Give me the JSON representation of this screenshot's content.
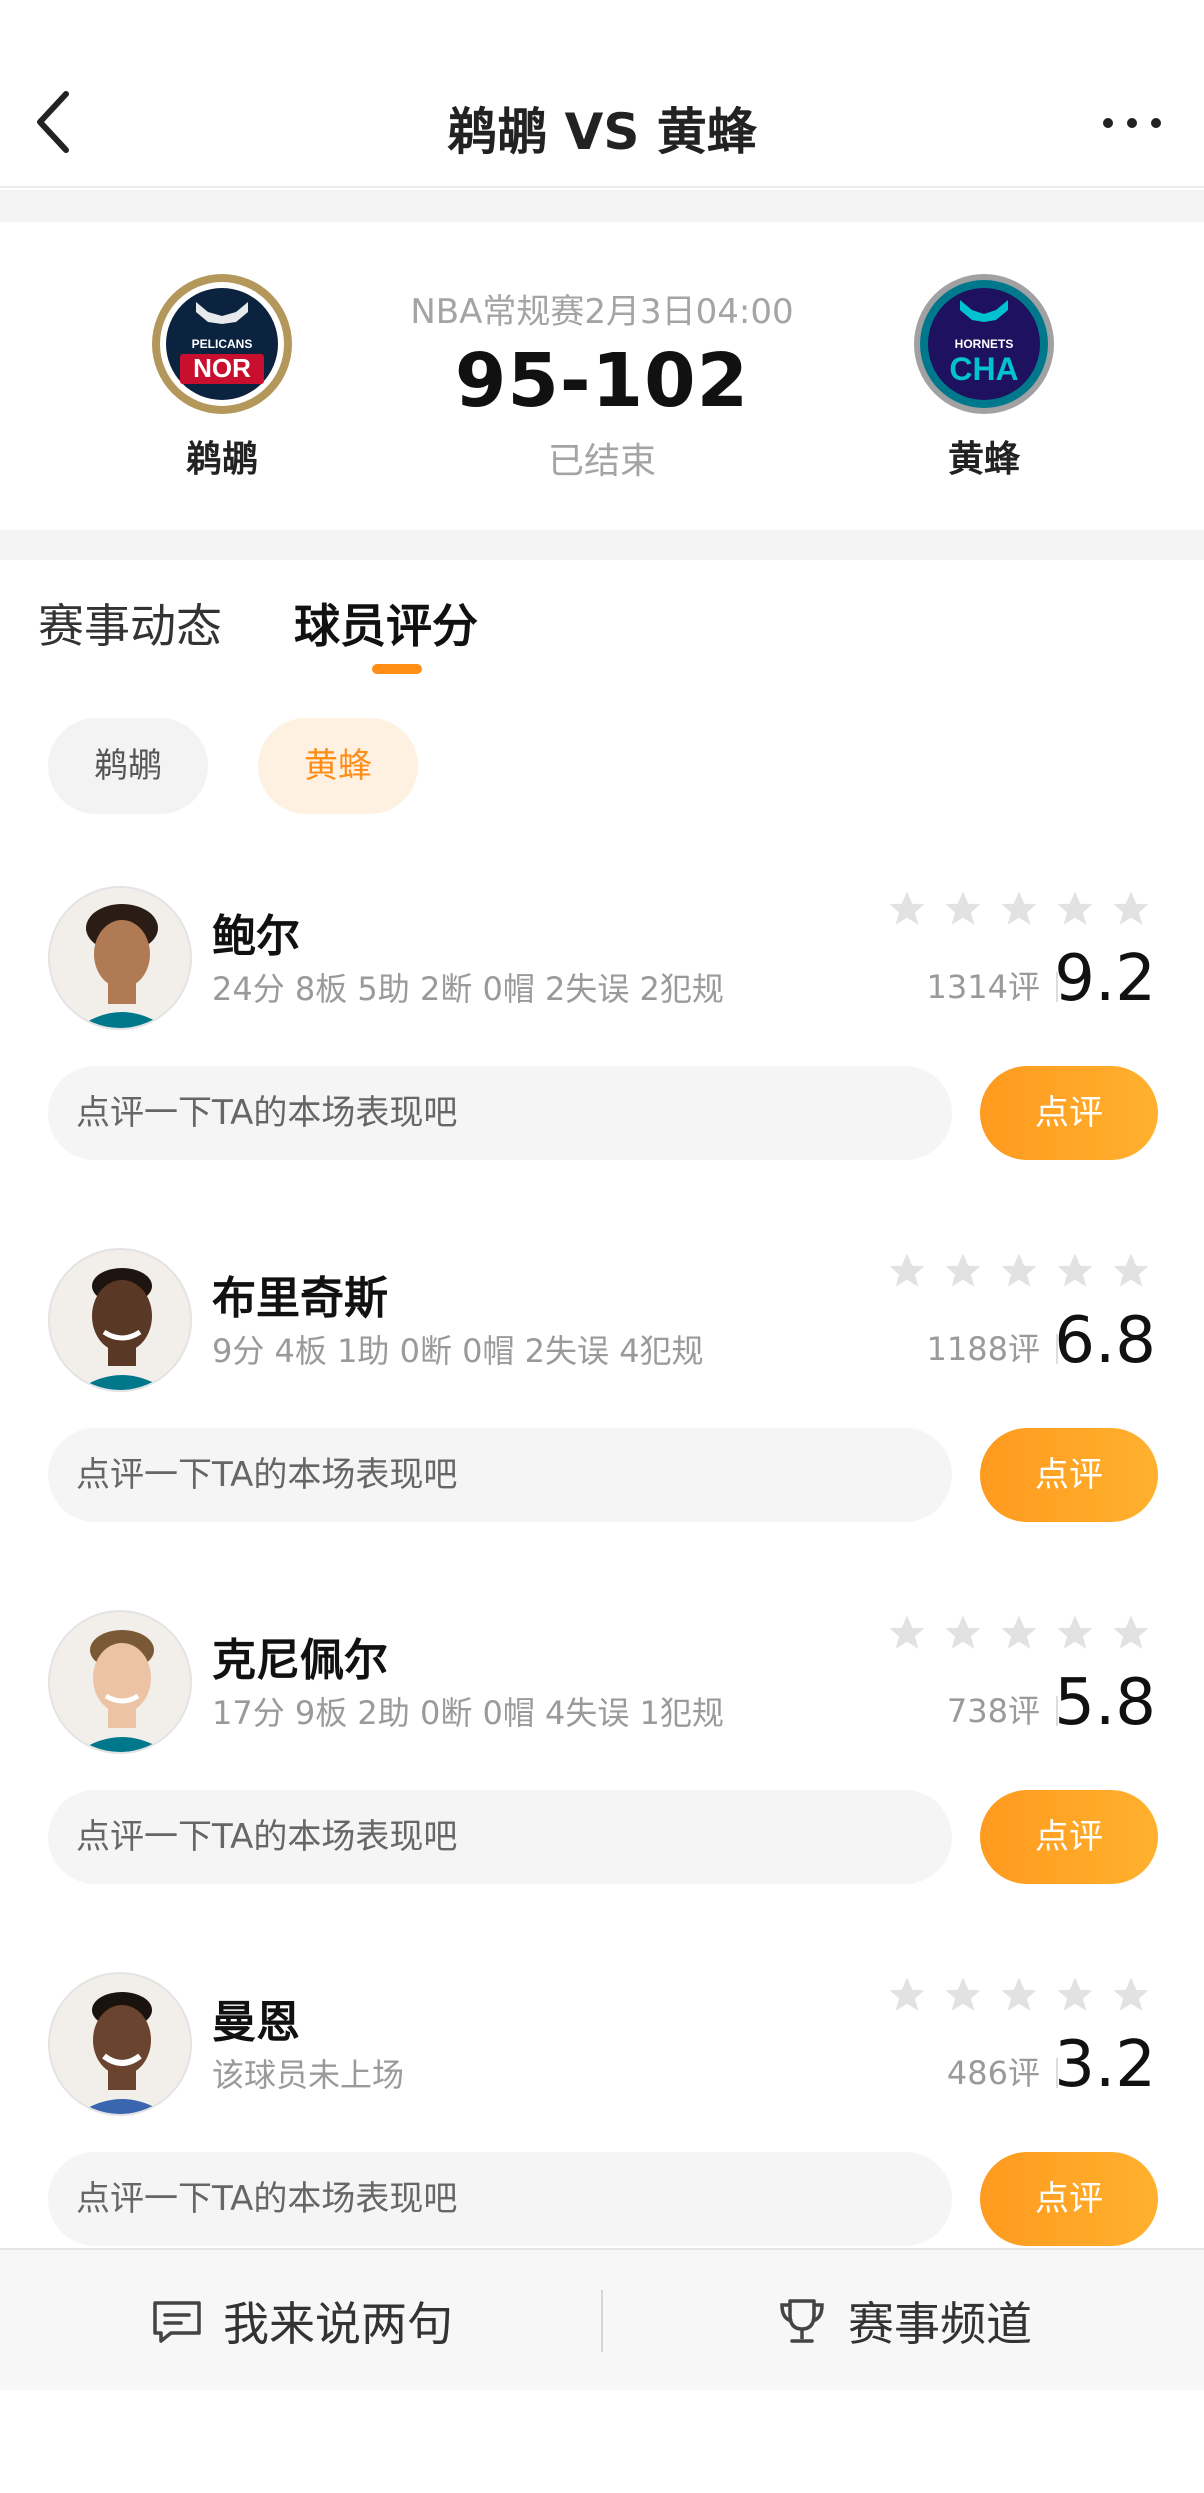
{
  "header": {
    "title": "鹈鹕 VS 黄蜂"
  },
  "match": {
    "info": "NBA常规赛2月3日04:00",
    "score": "95-102",
    "status": "已结束",
    "home": {
      "name": "鹈鹕",
      "logo_top": "PELICANS",
      "logo_abbr": "NOR",
      "color": "#0c2340",
      "accent": "#c8102e",
      "ring": "#b4975a"
    },
    "away": {
      "name": "黄蜂",
      "logo_top": "HORNETS",
      "logo_abbr": "CHA",
      "color": "#00788c",
      "accent": "#1d1160",
      "ring": "#a1a1a4"
    }
  },
  "tabs": [
    {
      "label": "赛事动态"
    },
    {
      "label": "球员评分"
    }
  ],
  "team_filter": [
    {
      "label": "鹈鹕"
    },
    {
      "label": "黄蜂"
    }
  ],
  "players": [
    {
      "name": "鲍尔",
      "stats": "24分 8板 5助 2断 0帽 2失误 2犯规",
      "rating_count": "1314评",
      "score": "9.2",
      "comment_placeholder": "点评一下TA的本场表现吧",
      "comment_button": "点评"
    },
    {
      "name": "布里奇斯",
      "stats": "9分 4板 1助 0断 0帽 2失误 4犯规",
      "rating_count": "1188评",
      "score": "6.8",
      "comment_placeholder": "点评一下TA的本场表现吧",
      "comment_button": "点评"
    },
    {
      "name": "克尼佩尔",
      "stats": "17分 9板 2助 0断 0帽 4失误 1犯规",
      "rating_count": "738评",
      "score": "5.8",
      "comment_placeholder": "点评一下TA的本场表现吧",
      "comment_button": "点评"
    },
    {
      "name": "曼恩",
      "stats": "该球员未上场",
      "rating_count": "486评",
      "score": "3.2",
      "comment_placeholder": "点评一下TA的本场表现吧",
      "comment_button": "点评"
    }
  ],
  "bottom_bar": {
    "left_label": "我来说两句",
    "right_label": "赛事频道"
  },
  "colors": {
    "accent": "#ff8d16",
    "star_empty": "#e2e2e2"
  }
}
